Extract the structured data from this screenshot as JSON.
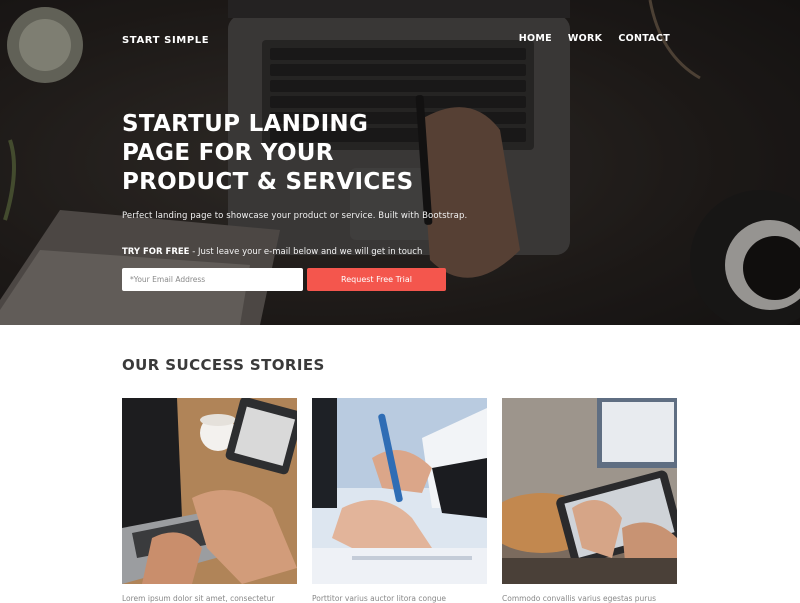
{
  "nav": {
    "brand": "START SIMPLE",
    "links": [
      "HOME",
      "WORK",
      "CONTACT"
    ]
  },
  "hero": {
    "title": "STARTUP LANDING PAGE FOR YOUR PRODUCT & SERVICES",
    "subtitle": "Perfect landing page to showcase your product or service. Built with Bootstrap.",
    "trial_label": "TRY FOR FREE",
    "trial_text": " - Just leave your e-mail below and we will get in touch",
    "email_placeholder": "*Your Email Address",
    "cta_label": "Request Free Trial"
  },
  "stories": {
    "title": "OUR SUCCESS STORIES",
    "cards": [
      {
        "caption": "Lorem ipsum dolor sit amet, consectetur"
      },
      {
        "caption": "Porttitor varius auctor litora congue"
      },
      {
        "caption": "Commodo convallis varius egestas purus"
      }
    ]
  },
  "colors": {
    "accent": "#f4564d",
    "hero_dark": "#23201d",
    "heading": "#3a3a3a",
    "caption": "#888888"
  },
  "icons": [
    "laptop-photo",
    "handshake-photo",
    "tablet-photo"
  ]
}
